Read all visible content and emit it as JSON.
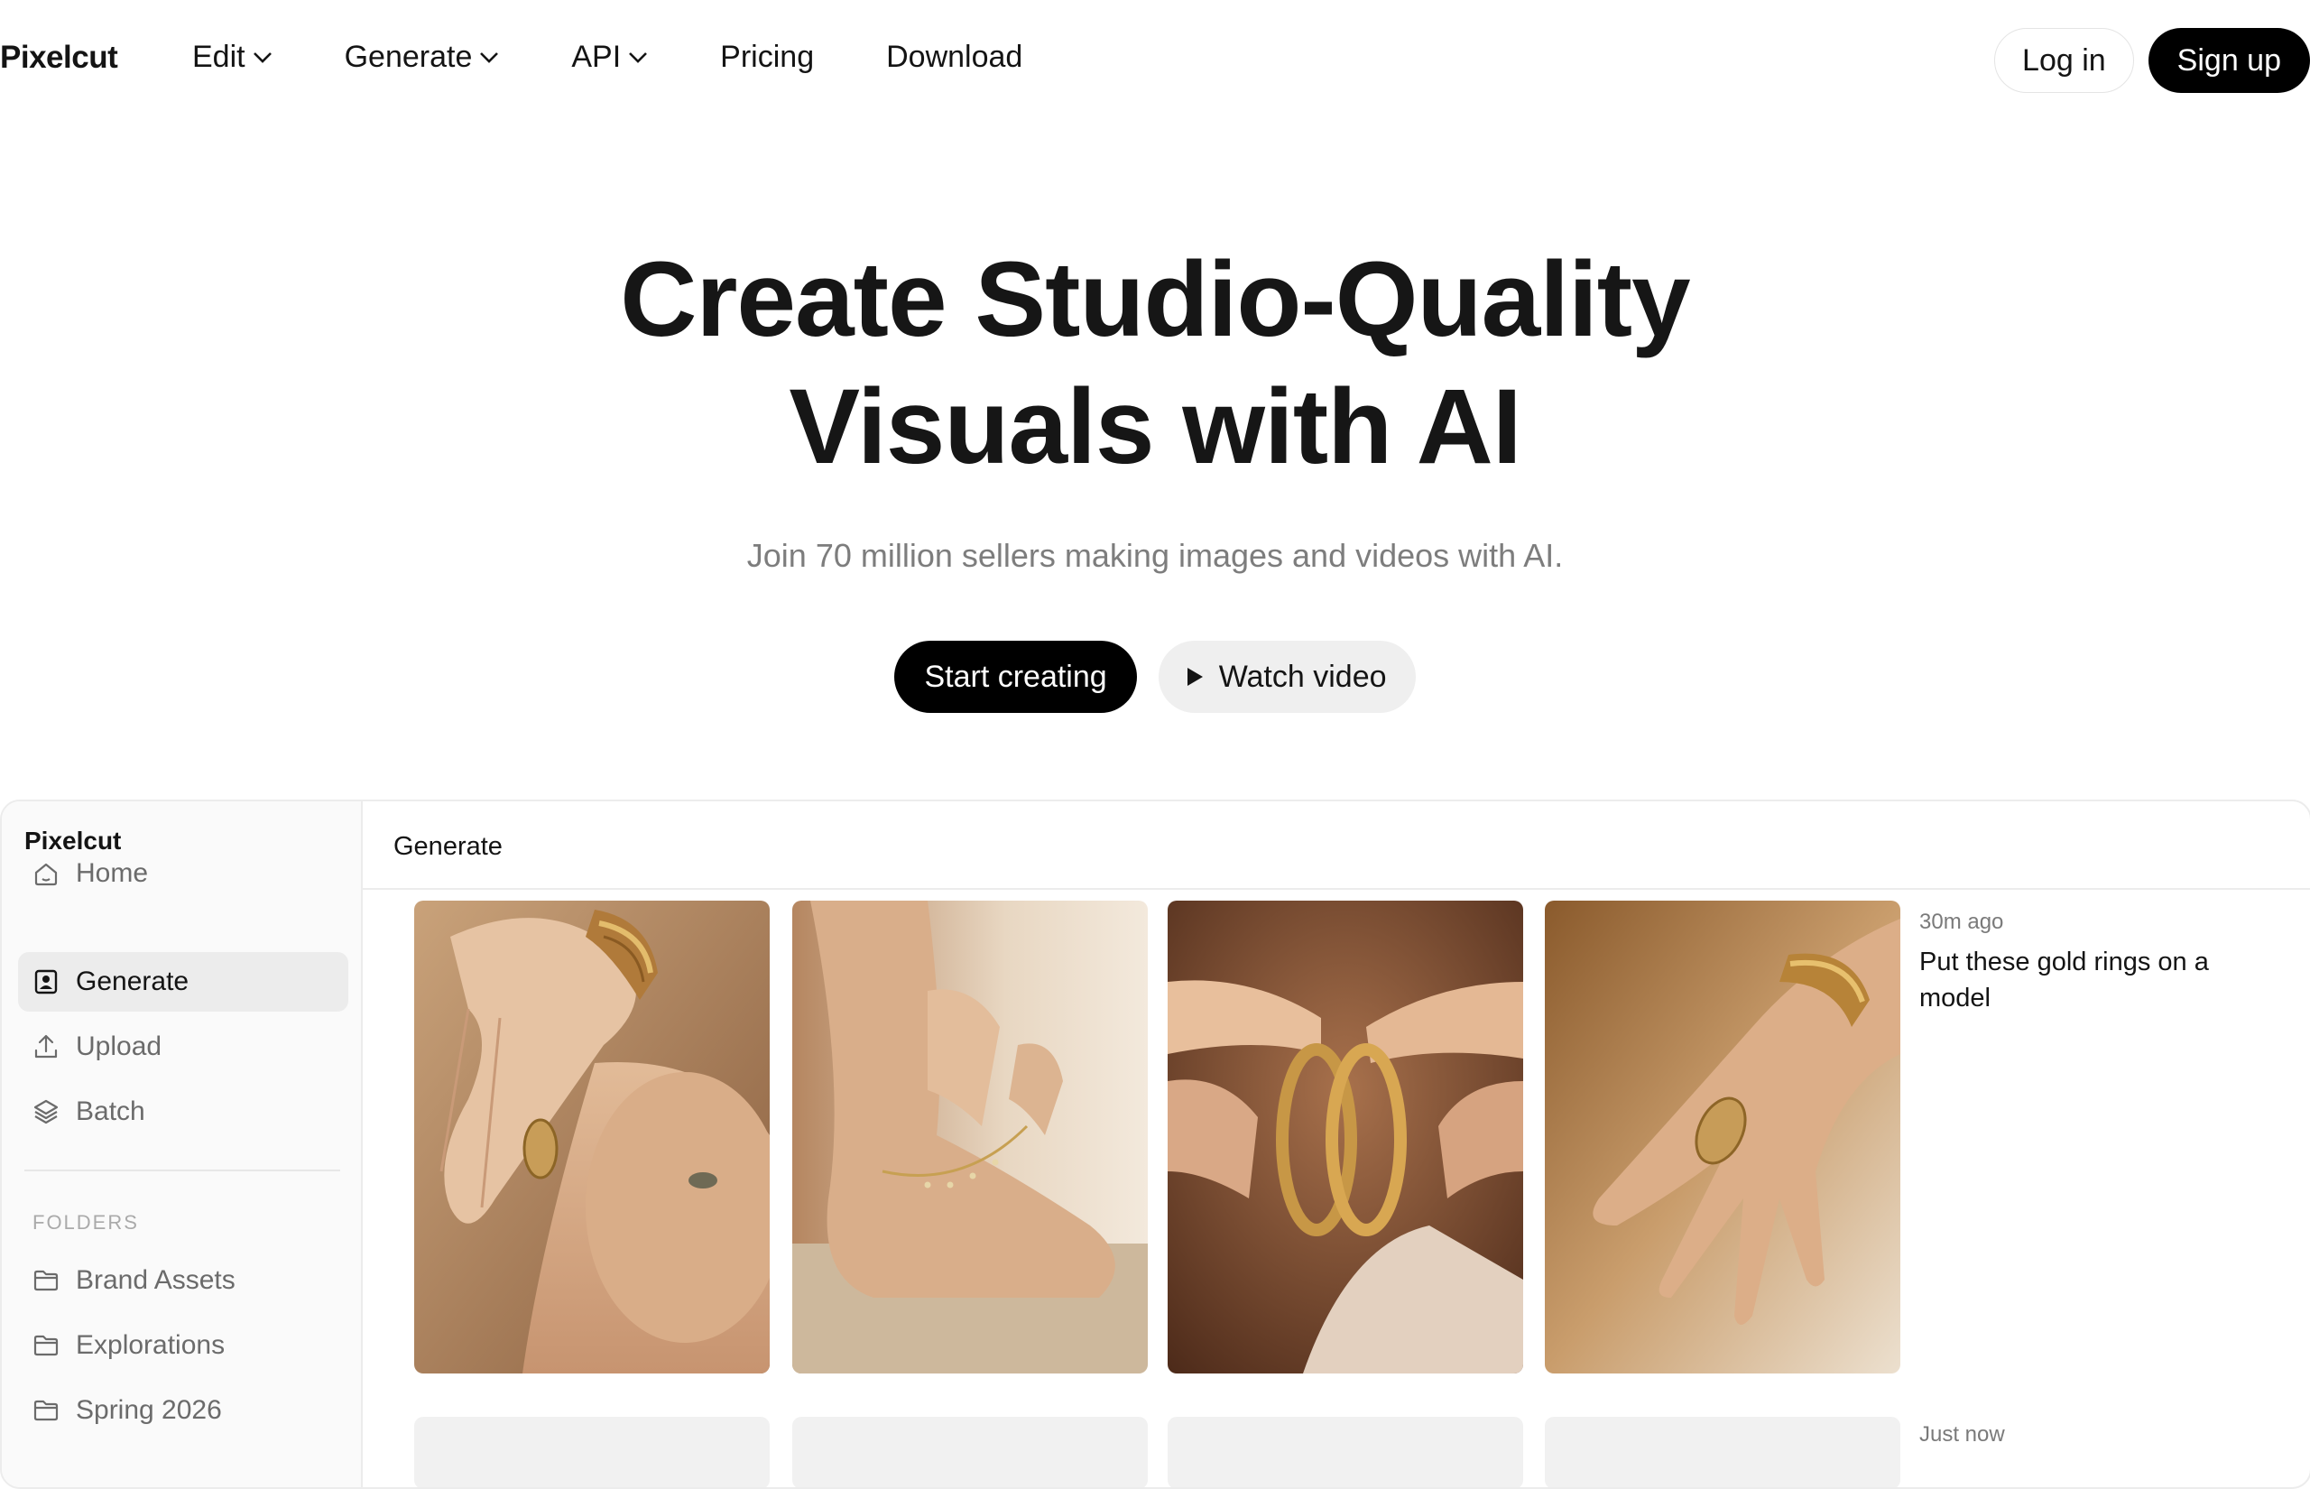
{
  "nav": {
    "logo": "Pixelcut",
    "links": [
      {
        "label": "Edit",
        "has_dropdown": true
      },
      {
        "label": "Generate",
        "has_dropdown": true
      },
      {
        "label": "API",
        "has_dropdown": true
      },
      {
        "label": "Pricing",
        "has_dropdown": false
      },
      {
        "label": "Download",
        "has_dropdown": false
      }
    ],
    "login": "Log in",
    "signup": "Sign up"
  },
  "hero": {
    "title_line1": "Create Studio-Quality",
    "title_line2": "Visuals with AI",
    "subtitle": "Join 70 million sellers making images and videos with AI.",
    "cta_primary": "Start creating",
    "cta_secondary": "Watch video"
  },
  "app": {
    "brand": "Pixelcut",
    "sidebar": {
      "items": [
        {
          "label": "Home",
          "icon": "home-icon",
          "active": false
        },
        {
          "label": "Generate",
          "icon": "image-portrait-icon",
          "active": true
        },
        {
          "label": "Upload",
          "icon": "upload-icon",
          "active": false
        },
        {
          "label": "Batch",
          "icon": "layers-icon",
          "active": false
        }
      ],
      "folders_heading": "FOLDERS",
      "folders": [
        {
          "label": "Brand Assets",
          "icon": "folder-icon"
        },
        {
          "label": "Explorations",
          "icon": "folder-icon"
        },
        {
          "label": "Spring 2026",
          "icon": "folder-icon"
        }
      ]
    },
    "main": {
      "title": "Generate",
      "generations": [
        {
          "time": "30m ago",
          "prompt": "Put these gold rings on a model",
          "images": [
            "model wearing gold ring and bracelet, hand on face",
            "ankle with gold anklet",
            "hands holding gold hoop earrings",
            "hand with gold ring and bracelet"
          ]
        },
        {
          "time": "Just now",
          "prompt": "",
          "images": []
        }
      ]
    }
  },
  "colors": {
    "primary_button": "#000000",
    "secondary_button": "#efefef",
    "muted_text": "#7d7d7d",
    "sidebar_bg": "#fafafa",
    "active_item_bg": "#ececec"
  }
}
